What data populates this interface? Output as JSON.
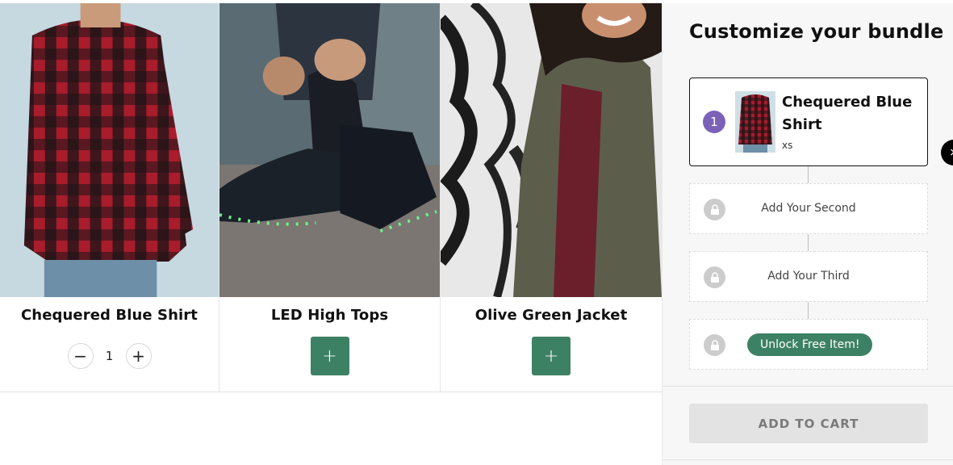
{
  "products": [
    {
      "name": "Chequered Blue Shirt",
      "image_icon": "plaid-shirt-photo",
      "quantity": "1",
      "minus": "−",
      "plus": "+"
    },
    {
      "name": "LED High Tops",
      "image_icon": "led-sneakers-photo",
      "add": "+"
    },
    {
      "name": "Olive Green Jacket",
      "image_icon": "olive-jacket-photo",
      "add": "+"
    }
  ],
  "bundle": {
    "title": "Customize your bundle",
    "selected": {
      "step": "1",
      "name": "Chequered Blue Shirt",
      "size": "xs",
      "remove": "×"
    },
    "slots": [
      {
        "label": "Add Your Second"
      },
      {
        "label": "Add Your Third"
      },
      {
        "label": "Unlock Free Item!"
      }
    ],
    "cta": "ADD TO CART"
  },
  "colors": {
    "accent": "#3d8164",
    "step_badge": "#7b62b8",
    "lock": "#cccccc"
  }
}
